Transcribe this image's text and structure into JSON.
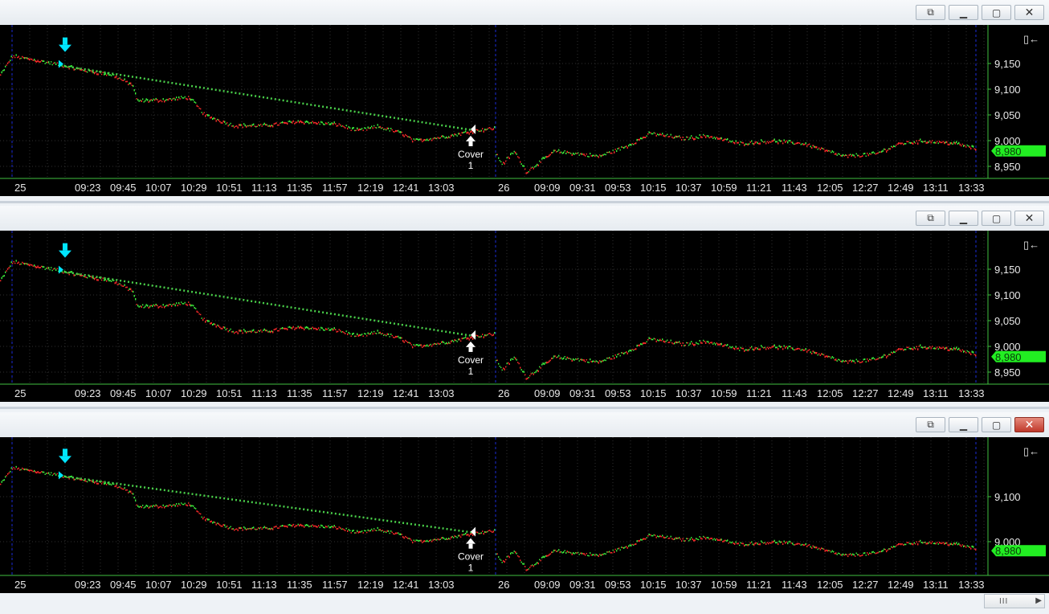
{
  "colors": {
    "up": "#ff2a2a",
    "down": "#3cf03c",
    "accent": "#00e5ff",
    "trend": "#4ad04a",
    "price_tag": "#22ee22",
    "session": "#1c2bd8"
  },
  "window_buttons": {
    "detach": "detach-icon",
    "minimize": "minimize-icon",
    "maximize": "maximize-icon",
    "close": "close-icon"
  },
  "window_button_glyphs": {
    "detach": "⧉",
    "minimize": "▁",
    "maximize": "▢",
    "close": "✕"
  },
  "panes": [
    {
      "name": "chart-pane-1",
      "price_ticks": [
        "9,150",
        "9,100",
        "9,050",
        "9,000",
        "8,950"
      ],
      "last_price": "8,980",
      "date_labels": [
        "25",
        "26"
      ],
      "time_labels_day1": [
        "09:23",
        "09:45",
        "10:07",
        "10:29",
        "10:51",
        "11:13",
        "11:35",
        "11:57",
        "12:19",
        "12:41",
        "13:03"
      ],
      "time_labels_day2": [
        "09:09",
        "09:31",
        "09:53",
        "10:15",
        "10:37",
        "10:59",
        "11:21",
        "11:43",
        "12:05",
        "12:27",
        "12:49",
        "13:11",
        "13:33"
      ],
      "annotation": {
        "label": "Cover",
        "qty": "1"
      },
      "close_active": false
    },
    {
      "name": "chart-pane-2",
      "price_ticks": [
        "9,150",
        "9,100",
        "9,050",
        "9,000",
        "8,950"
      ],
      "last_price": "8,980",
      "date_labels": [
        "25",
        "26"
      ],
      "time_labels_day1": [
        "09:23",
        "09:45",
        "10:07",
        "10:29",
        "10:51",
        "11:13",
        "11:35",
        "11:57",
        "12:19",
        "12:41",
        "13:03"
      ],
      "time_labels_day2": [
        "09:09",
        "09:31",
        "09:53",
        "10:15",
        "10:37",
        "10:59",
        "11:21",
        "11:43",
        "12:05",
        "12:27",
        "12:49",
        "13:11",
        "13:33"
      ],
      "annotation": {
        "label": "Cover",
        "qty": "1"
      },
      "close_active": false
    },
    {
      "name": "chart-pane-3",
      "price_ticks": [
        "9,100",
        "9,000"
      ],
      "last_price": "8,980",
      "date_labels": [
        "25",
        "26"
      ],
      "time_labels_day1": [
        "09:23",
        "09:45",
        "10:07",
        "10:29",
        "10:51",
        "11:13",
        "11:35",
        "11:57",
        "12:19",
        "12:41",
        "13:03"
      ],
      "time_labels_day2": [
        "09:09",
        "09:31",
        "09:53",
        "10:15",
        "10:37",
        "10:59",
        "11:21",
        "11:43",
        "12:05",
        "12:27",
        "12:49",
        "13:11",
        "13:33"
      ],
      "annotation": {
        "label": "Cover",
        "qty": "1"
      },
      "close_active": true
    }
  ],
  "scrollbar": {
    "grip": "III",
    "arrow": "▶"
  }
}
